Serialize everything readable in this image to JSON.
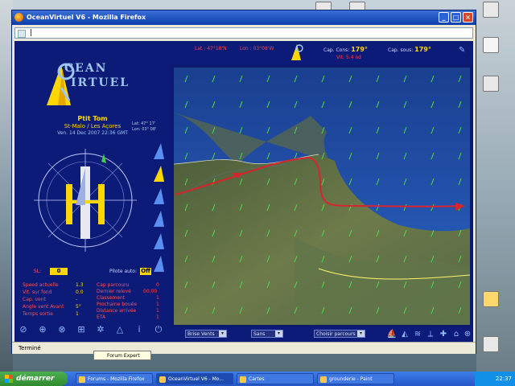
{
  "window": {
    "title": "OceanVirtuel V6 - Mozilla Firefox",
    "url": "|",
    "status": "Terminé"
  },
  "app": {
    "logo_line1": "CEAN",
    "logo_line2": "IRTUEL",
    "boat_name": "Ptit Tom",
    "route": "St-Malo / Les Açores",
    "datetime": "Ven. 14 Dec 2007 22:36 GMT",
    "coords_lat": "Lat: 47° 17'",
    "coords_lon": "Lon: 03° 08'",
    "top": {
      "lat": "Lat : 47°18'N",
      "lon": "Lon : 03°08'W",
      "cap_label": "Cap. Cons:",
      "cap_value": "179°",
      "cap_sub": "",
      "cap_hrd": "Cap. sous:",
      "cap_hrd_value": "179°",
      "cap_hrd_sub": "Vit: 5.4 nd"
    },
    "sl_label": "SL:",
    "sl_value": "0",
    "pilot_label": "Pilote auto:",
    "pilot_value": "Off",
    "fields_left": [
      {
        "label": "Speed actuelle",
        "value": "1.3"
      },
      {
        "label": "Vit. sur fond",
        "value": "0.0"
      },
      {
        "label": "Cap. vent",
        "value": "-"
      },
      {
        "label": "Angle vent Avant",
        "value": "5°"
      },
      {
        "label": "Temps sortie",
        "value": "1"
      }
    ],
    "fields_right": [
      {
        "label": "Cap parcouru",
        "value": "0"
      },
      {
        "label": "Dernier relevé",
        "value": "00:00"
      },
      {
        "label": "Classement",
        "value": "1"
      },
      {
        "label": "Prochaine bouée",
        "value": "1"
      },
      {
        "label": "Distance arrivée",
        "value": "1"
      },
      {
        "label": "ETA",
        "value": "1"
      }
    ],
    "toolbar": {
      "select1": "Brise Vents",
      "select2": "Sans",
      "select3": "Choisir parcours"
    }
  },
  "taskbar": {
    "start": "démarrer",
    "tasks": [
      "Forums - Mozilla Firefox",
      "OceanVirtuel V6 - Mo...",
      "Cartes",
      "grounderie - Paint"
    ],
    "tooltip": "Forum Expert",
    "clock": "22:37"
  },
  "colors": {
    "panel": "#0c1b78",
    "accent": "#ffd700",
    "route": "#d8242f",
    "sea": "#1c4fa8"
  }
}
